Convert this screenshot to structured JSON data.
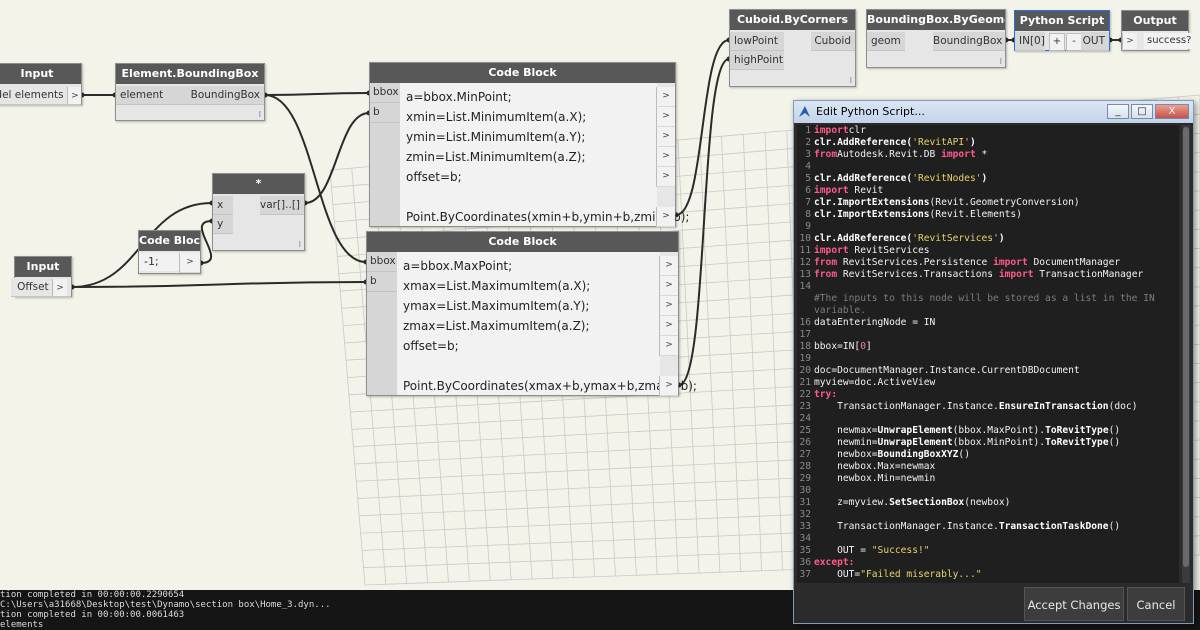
{
  "nodes": {
    "input_elements": {
      "title": "Input",
      "out_port": "odel elements"
    },
    "element_bbox": {
      "title": "Element.BoundingBox",
      "in_port": "element",
      "out_port": "BoundingBox",
      "lacing": "l"
    },
    "code_block_min": {
      "title": "Code Block",
      "in_ports": [
        "bbox",
        "b"
      ],
      "lines": [
        "a=bbox.MinPoint;",
        "xmin=List.MinimumItem(a.X);",
        "ymin=List.MinimumItem(a.Y);",
        "zmin=List.MinimumItem(a.Z);",
        "offset=b;",
        "",
        "Point.ByCoordinates(xmin+b,ymin+b,zmin+b);"
      ]
    },
    "code_block_max": {
      "title": "Code Block",
      "in_ports": [
        "bbox",
        "b"
      ],
      "lines": [
        "a=bbox.MaxPoint;",
        "xmax=List.MaximumItem(a.X);",
        "ymax=List.MaximumItem(a.Y);",
        "zmax=List.MaximumItem(a.Z);",
        "offset=b;",
        "",
        "Point.ByCoordinates(xmax+b,ymax+b,zmax+b);"
      ]
    },
    "multiply": {
      "title": "*",
      "in_ports": [
        "x",
        "y"
      ],
      "out_port": "var[]..[]",
      "lacing": "l"
    },
    "code_block_neg": {
      "title": "Code Block",
      "value": "-1;"
    },
    "input_offset": {
      "title": "Input",
      "out_port": "Offset"
    },
    "cuboid": {
      "title": "Cuboid.ByCorners",
      "in_ports": [
        "lowPoint",
        "highPoint"
      ],
      "out_port": "Cuboid",
      "lacing": "l"
    },
    "bbox_geom": {
      "title": "BoundingBox.ByGeometry",
      "in_port": "geom",
      "out_port": "BoundingBox",
      "lacing": "l"
    },
    "python_script": {
      "title": "Python Script",
      "in_port": "IN[0]",
      "add": "+",
      "remove": "-",
      "out_port": "OUT"
    },
    "output": {
      "title": "Output",
      "out_port": "success?"
    }
  },
  "arrow_glyph": ">",
  "console": {
    "lines": [
      "tion completed in 00:00:00.2290654",
      "C:\\Users\\a31668\\Desktop\\test\\Dynamo\\section box\\Home_3.dyn...",
      "tion completed in 00:00:00.0061463",
      "elements"
    ]
  },
  "editor": {
    "title": "Edit Python Script...",
    "window_buttons": {
      "minimize": "_",
      "maximize": "□",
      "close": "X"
    },
    "accept_label": "Accept Changes",
    "cancel_label": "Cancel",
    "code_lines": [
      {
        "n": "1",
        "t": [
          [
            "kw",
            "import"
          ],
          [
            "",
            "clr"
          ]
        ]
      },
      {
        "n": "2",
        "t": [
          [
            "fn",
            "clr.AddReference("
          ],
          [
            "str",
            "'RevitAPI'"
          ],
          [
            "fn",
            ")"
          ]
        ]
      },
      {
        "n": "3",
        "t": [
          [
            "kw",
            "from"
          ],
          [
            "",
            "Autodesk.Revit.DB "
          ],
          [
            "kw",
            "import"
          ],
          [
            "",
            " *"
          ]
        ]
      },
      {
        "n": "4",
        "t": []
      },
      {
        "n": "5",
        "t": [
          [
            "fn",
            "clr.AddReference("
          ],
          [
            "str",
            "'RevitNodes'"
          ],
          [
            "fn",
            ")"
          ]
        ]
      },
      {
        "n": "6",
        "t": [
          [
            "kw",
            "import"
          ],
          [
            "",
            " Revit"
          ]
        ]
      },
      {
        "n": "7",
        "t": [
          [
            "fn",
            "clr.ImportExtensions"
          ],
          [
            "",
            "(Revit.GeometryConversion)"
          ]
        ]
      },
      {
        "n": "8",
        "t": [
          [
            "fn",
            "clr.ImportExtensions"
          ],
          [
            "",
            "(Revit.Elements)"
          ]
        ]
      },
      {
        "n": "9",
        "t": []
      },
      {
        "n": "10",
        "t": [
          [
            "fn",
            "clr.AddReference("
          ],
          [
            "str",
            "'RevitServices'"
          ],
          [
            "fn",
            ")"
          ]
        ]
      },
      {
        "n": "11",
        "t": [
          [
            "kw",
            "import"
          ],
          [
            "",
            " RevitServices"
          ]
        ]
      },
      {
        "n": "12",
        "t": [
          [
            "kw",
            "from"
          ],
          [
            "",
            " RevitServices.Persistence "
          ],
          [
            "kw",
            "import"
          ],
          [
            "",
            " DocumentManager"
          ]
        ]
      },
      {
        "n": "13",
        "t": [
          [
            "kw",
            "from"
          ],
          [
            "",
            " RevitServices.Transactions "
          ],
          [
            "kw",
            "import"
          ],
          [
            "",
            " TransactionManager"
          ]
        ]
      },
      {
        "n": "14",
        "t": []
      },
      {
        "n": "",
        "t": [
          [
            "cm",
            "#The inputs to this node will be stored as a list in the IN"
          ]
        ]
      },
      {
        "n": "",
        "t": [
          [
            "cm",
            "variable."
          ]
        ]
      },
      {
        "n": "16",
        "t": [
          [
            "",
            "dataEnteringNode = IN"
          ]
        ]
      },
      {
        "n": "17",
        "t": []
      },
      {
        "n": "18",
        "t": [
          [
            "",
            "bbox=IN["
          ],
          [
            "num",
            "0"
          ],
          [
            "",
            "]"
          ]
        ]
      },
      {
        "n": "19",
        "t": []
      },
      {
        "n": "20",
        "t": [
          [
            "",
            "doc=DocumentManager.Instance.CurrentDBDocument"
          ]
        ]
      },
      {
        "n": "21",
        "t": [
          [
            "",
            "myview=doc.ActiveView"
          ]
        ]
      },
      {
        "n": "22",
        "t": [
          [
            "kw",
            "try:"
          ]
        ]
      },
      {
        "n": "23",
        "t": [
          [
            "",
            "    TransactionManager.Instance."
          ],
          [
            "fn",
            "EnsureInTransaction"
          ],
          [
            "",
            "(doc)"
          ]
        ]
      },
      {
        "n": "24",
        "t": []
      },
      {
        "n": "25",
        "t": [
          [
            "",
            "    newmax="
          ],
          [
            "fn",
            "UnwrapElement"
          ],
          [
            "",
            "(bbox.MaxPoint)."
          ],
          [
            "fn",
            "ToRevitType"
          ],
          [
            "",
            "()"
          ]
        ]
      },
      {
        "n": "26",
        "t": [
          [
            "",
            "    newmin="
          ],
          [
            "fn",
            "UnwrapElement"
          ],
          [
            "",
            "(bbox.MinPoint)."
          ],
          [
            "fn",
            "ToRevitType"
          ],
          [
            "",
            "()"
          ]
        ]
      },
      {
        "n": "27",
        "t": [
          [
            "",
            "    newbox="
          ],
          [
            "fn",
            "BoundingBoxXYZ"
          ],
          [
            "",
            "()"
          ]
        ]
      },
      {
        "n": "28",
        "t": [
          [
            "",
            "    newbox.Max=newmax"
          ]
        ]
      },
      {
        "n": "29",
        "t": [
          [
            "",
            "    newbox.Min=newmin"
          ]
        ]
      },
      {
        "n": "30",
        "t": []
      },
      {
        "n": "31",
        "t": [
          [
            "",
            "    z=myview."
          ],
          [
            "fn",
            "SetSectionBox"
          ],
          [
            "",
            "(newbox)"
          ]
        ]
      },
      {
        "n": "32",
        "t": []
      },
      {
        "n": "33",
        "t": [
          [
            "",
            "    TransactionManager.Instance."
          ],
          [
            "fn",
            "TransactionTaskDone"
          ],
          [
            "",
            "()"
          ]
        ]
      },
      {
        "n": "34",
        "t": []
      },
      {
        "n": "35",
        "t": [
          [
            "",
            "    OUT = "
          ],
          [
            "str",
            "\"Success!\""
          ]
        ]
      },
      {
        "n": "36",
        "t": [
          [
            "kw",
            "except:"
          ]
        ]
      },
      {
        "n": "37",
        "t": [
          [
            "",
            "    OUT="
          ],
          [
            "str",
            "\"Failed miserably...\""
          ]
        ]
      }
    ]
  }
}
